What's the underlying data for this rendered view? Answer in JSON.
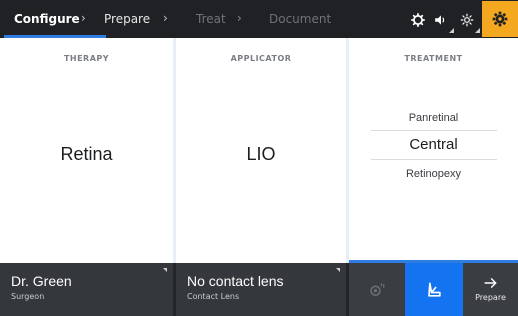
{
  "nav": {
    "steps": [
      {
        "label": "Configure",
        "state": "active"
      },
      {
        "label": "Prepare",
        "state": "enabled"
      },
      {
        "label": "Treat",
        "state": "disabled"
      },
      {
        "label": "Document",
        "state": "disabled"
      }
    ],
    "separator": "›",
    "icons": [
      "gear-outline-icon",
      "volume-icon",
      "brightness-icon",
      "settings-gear-icon"
    ]
  },
  "panels": {
    "therapy": {
      "header": "THERAPY",
      "value": "Retina"
    },
    "applicator": {
      "header": "APPLICATOR",
      "value": "LIO"
    },
    "treatment": {
      "header": "TREATMENT",
      "options": [
        "Panretinal",
        "Central",
        "Retinopexy"
      ],
      "selected": "Central"
    }
  },
  "bottom": {
    "surgeon": {
      "value": "Dr. Green",
      "label": "Surgeon"
    },
    "lens": {
      "value": "No contact lens",
      "label": "Contact Lens"
    },
    "next": {
      "label": "Prepare"
    }
  },
  "colors": {
    "accent": "#2f7de1",
    "active_button": "#1473f0",
    "settings": "#f4a81f",
    "nav_bg": "#1f2124",
    "bottom_bg": "#2f3236"
  }
}
